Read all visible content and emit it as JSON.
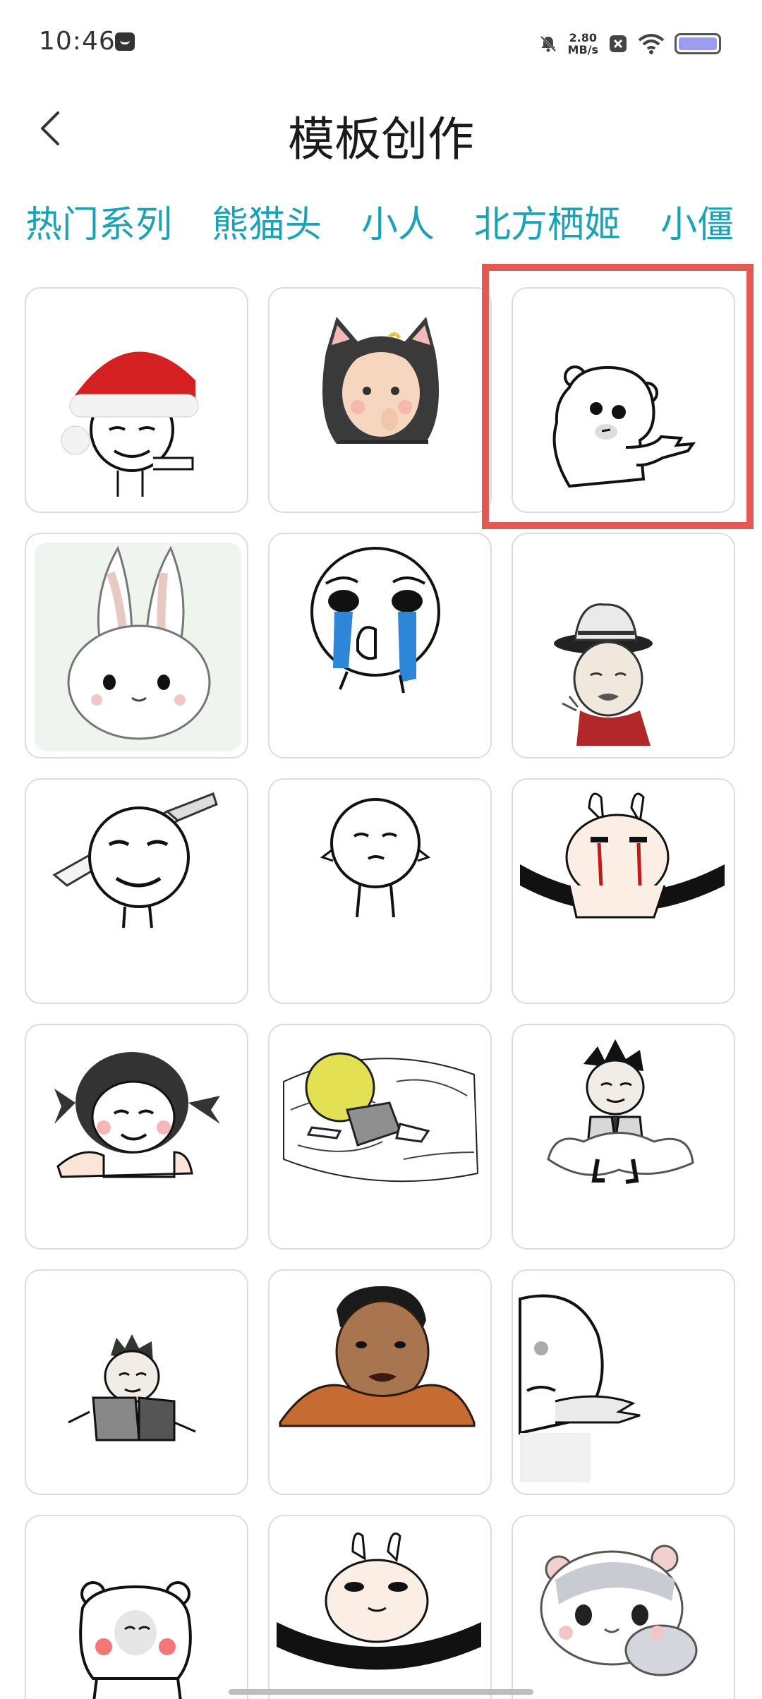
{
  "status_bar": {
    "time": "10:46",
    "net_speed_value": "2.80",
    "net_speed_unit": "MB/s",
    "icons": [
      "message-icon",
      "mute-icon",
      "close-box-icon",
      "wifi-icon",
      "battery-icon"
    ]
  },
  "header": {
    "title": "模板创作",
    "back_icon": "chevron-left-icon"
  },
  "tabs": [
    {
      "label": "热门系列",
      "active": true
    },
    {
      "label": "熊猫头",
      "active": false
    },
    {
      "label": "小人",
      "active": false
    },
    {
      "label": "北方栖姬",
      "active": false
    },
    {
      "label": "小僵",
      "active": false
    }
  ],
  "templates": [
    {
      "subject": "santa-hat-meme-face"
    },
    {
      "subject": "girl-in-cat-hood"
    },
    {
      "subject": "pointing-bear",
      "highlighted": true
    },
    {
      "subject": "bunny-with-big-ears"
    },
    {
      "subject": "crying-face"
    },
    {
      "subject": "old-man-with-hat"
    },
    {
      "subject": "meme-face-with-knife"
    },
    {
      "subject": "confused-round-head"
    },
    {
      "subject": "bunny-crying-blood"
    },
    {
      "subject": "pigtail-girl-meme"
    },
    {
      "subject": "yellow-head-in-bed"
    },
    {
      "subject": "cartoon-guy-on-cloud"
    },
    {
      "subject": "reading-boy-meme"
    },
    {
      "subject": "chubby-man-orange-shirt"
    },
    {
      "subject": "half-face-pointing"
    },
    {
      "subject": "blushing-bear-meme"
    },
    {
      "subject": "bunny-with-scarf"
    },
    {
      "subject": "hamster"
    }
  ],
  "colors": {
    "accent": "#1aa3b8",
    "highlight": "#e35a55",
    "card_border": "#dcdcdc"
  }
}
